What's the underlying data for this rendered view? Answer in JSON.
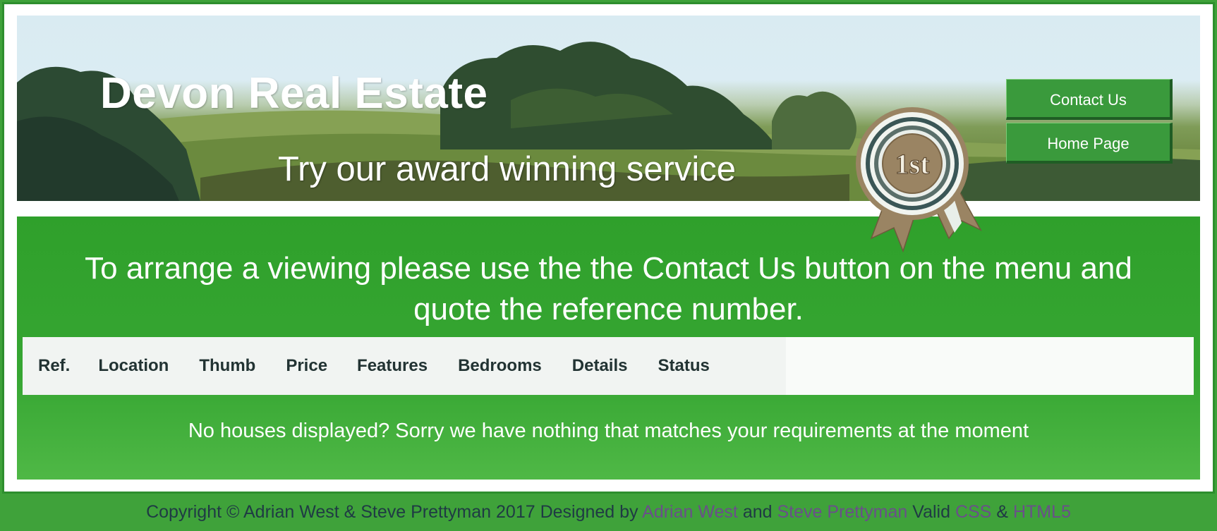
{
  "header": {
    "title": "Devon Real Estate",
    "tagline": "Try our award winning service",
    "badge": "1st"
  },
  "nav": {
    "items": [
      {
        "label": "Contact Us"
      },
      {
        "label": "Home Page"
      }
    ]
  },
  "main": {
    "intro_line1": "To arrange a viewing please use the the Contact Us button on the menu and",
    "intro_line2": "quote the reference number.",
    "columns": [
      "Ref.",
      "Location",
      "Thumb",
      "Price",
      "Features",
      "Bedrooms",
      "Details",
      "Status"
    ],
    "empty_message": "No houses displayed? Sorry we have nothing that matches your requirements at the moment"
  },
  "footer": {
    "copyright": "Copyright © Adrian West & Steve Prettyman 2017 Designed by",
    "designer1": "Adrian West",
    "and": "and",
    "designer2": "Steve Prettyman",
    "valid": "Valid",
    "css_link": "CSS",
    "amp": "&",
    "html5_link": "HTML5"
  },
  "colors": {
    "page_bg": "#3fa23a",
    "panel_green": "#2fa02b",
    "button_green": "#3a9a3c",
    "link_purple": "#6a4f8a"
  }
}
